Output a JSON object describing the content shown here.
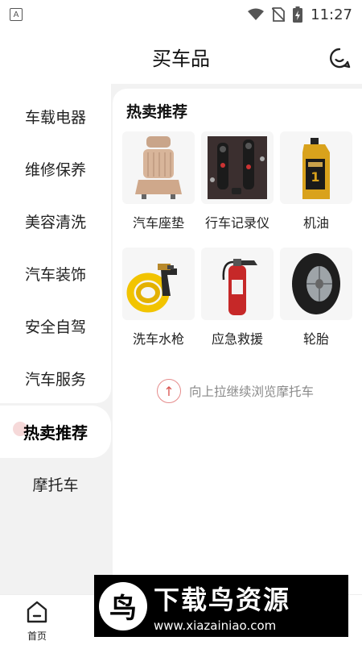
{
  "status_bar": {
    "time": "11:27",
    "notif_letter": "A"
  },
  "header": {
    "title": "买车品"
  },
  "sidebar": {
    "items": [
      {
        "label": "车载电器"
      },
      {
        "label": "维修保养"
      },
      {
        "label": "美容清洗"
      },
      {
        "label": "汽车装饰"
      },
      {
        "label": "安全自驾"
      },
      {
        "label": "汽车服务"
      },
      {
        "label": "热卖推荐"
      },
      {
        "label": "摩托车"
      }
    ],
    "active_index": 6
  },
  "content": {
    "section_title": "热卖推荐",
    "products": [
      {
        "label": "汽车座垫",
        "icon": "seat-cushion-icon"
      },
      {
        "label": "行车记录仪",
        "icon": "dashcam-icon"
      },
      {
        "label": "机油",
        "icon": "motor-oil-icon"
      },
      {
        "label": "洗车水枪",
        "icon": "spray-gun-icon"
      },
      {
        "label": "应急救援",
        "icon": "fire-extinguisher-icon"
      },
      {
        "label": "轮胎",
        "icon": "tire-icon"
      }
    ],
    "hint": "向上拉继续浏览摩托车"
  },
  "bottom_nav": {
    "home_label": "首页"
  },
  "watermark": {
    "brand": "下载鸟资源",
    "url": "www.xiazainiao.com"
  },
  "colors": {
    "accent": "#d9534f",
    "background": "#f2f2f2"
  }
}
